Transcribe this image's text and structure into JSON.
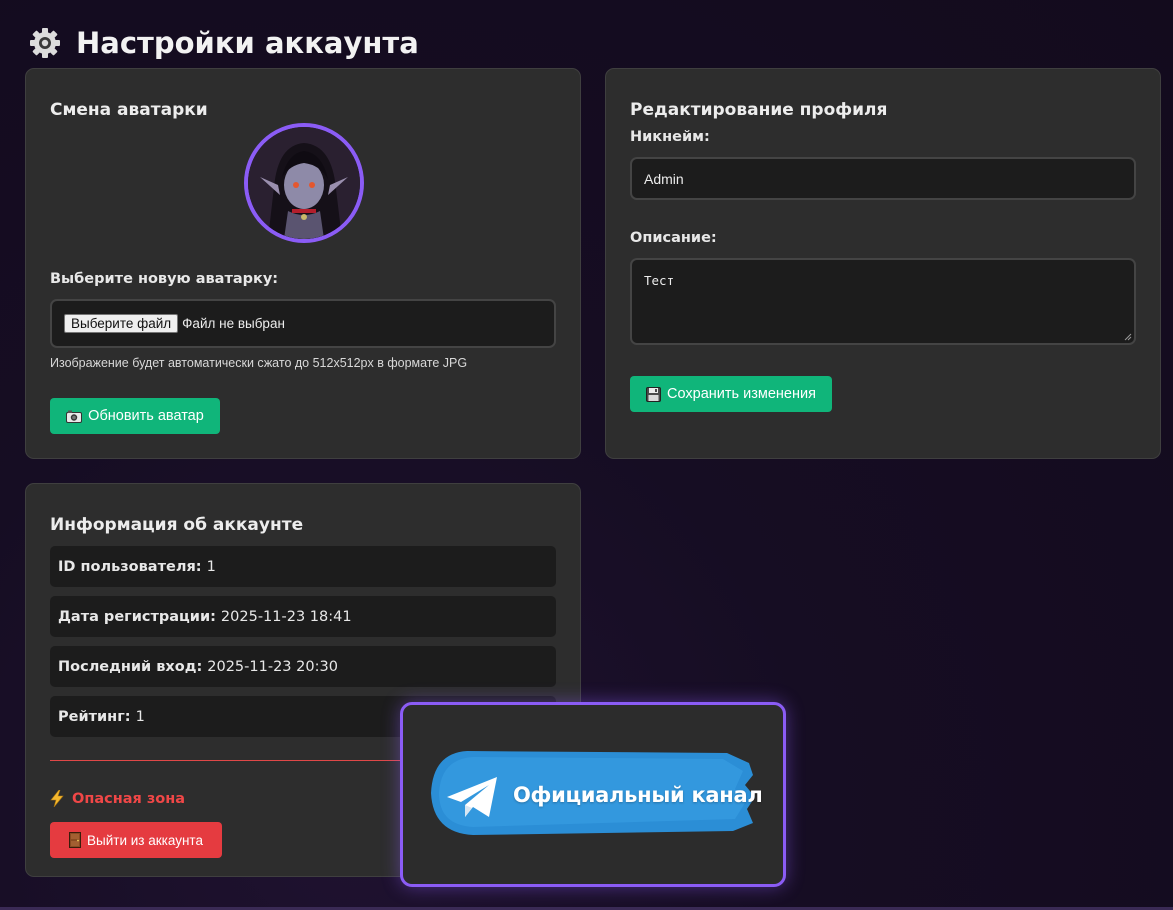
{
  "page": {
    "title": "Настройки аккаунта"
  },
  "avatar_card": {
    "title": "Смена аватарки",
    "select_label": "Выберите новую аватарку:",
    "file_button": "Выберите файл",
    "file_status": "Файл не выбран",
    "hint": "Изображение будет автоматически сжато до 512x512px в формате JPG",
    "update_button": "Обновить аватар"
  },
  "profile_card": {
    "title": "Редактирование профиля",
    "nickname_label": "Никнейм:",
    "nickname_value": "Admin",
    "description_label": "Описание:",
    "description_value": "Тест",
    "save_button": "Сохранить изменения"
  },
  "info_card": {
    "title": "Информация об аккаунте",
    "rows": [
      {
        "label": "ID пользователя:",
        "value": "1"
      },
      {
        "label": "Дата регистрации:",
        "value": "2025-11-23 18:41"
      },
      {
        "label": "Последний вход:",
        "value": "2025-11-23 20:30"
      },
      {
        "label": "Рейтинг:",
        "value": "1"
      }
    ],
    "danger_title": "Опасная зона",
    "logout_button": "Выйти из аккаунта"
  },
  "telegram_banner": {
    "text": "Официальный канал"
  },
  "icons": {
    "page": "gear-icon",
    "update_avatar": "camera-icon",
    "save": "floppy-disk-icon",
    "danger": "lightning-icon",
    "logout": "door-icon",
    "banner": "telegram-icon"
  },
  "colors": {
    "accent_purple": "#8b5cf6",
    "green": "#10b57a",
    "red": "#e53b40",
    "danger_text": "#f04747",
    "telegram_blue": "#2b8ed6"
  }
}
